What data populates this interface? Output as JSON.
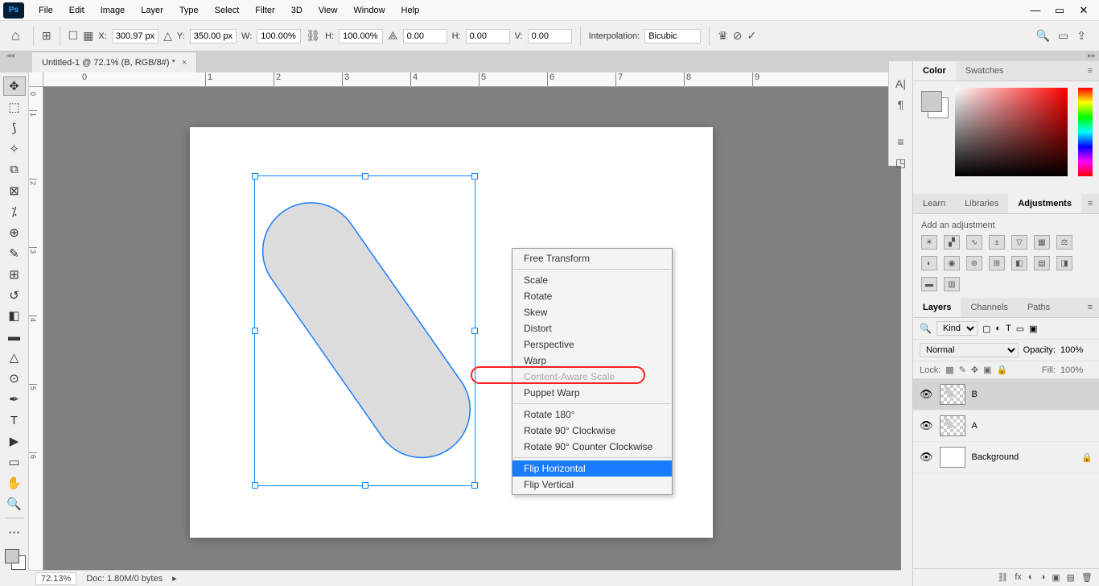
{
  "menu": {
    "items": [
      "File",
      "Edit",
      "Image",
      "Layer",
      "Type",
      "Select",
      "Filter",
      "3D",
      "View",
      "Window",
      "Help"
    ]
  },
  "options": {
    "x_label": "X:",
    "x_val": "300.97 px",
    "y_label": "Y:",
    "y_val": "350.00 px",
    "w_label": "W:",
    "w_val": "100.00%",
    "h_label": "H:",
    "h_val": "100.00%",
    "rot_val": "0.00",
    "hskew_label": "H:",
    "hskew_val": "0.00",
    "vskew_label": "V:",
    "vskew_val": "0.00",
    "interp_label": "Interpolation:",
    "interp_val": "Bicubic"
  },
  "tab": {
    "title": "Untitled-1 @ 72.1% (B, RGB/8#) *"
  },
  "ruler_h": [
    "0",
    "1",
    "2",
    "3",
    "4",
    "5",
    "6",
    "7",
    "8",
    "9"
  ],
  "ruler_v": [
    "0",
    "1",
    "2",
    "3",
    "4",
    "5",
    "6"
  ],
  "context_menu": {
    "items": [
      {
        "label": "Free Transform",
        "disabled": false,
        "sep_after": true,
        "highlighted": false
      },
      {
        "label": "Scale",
        "disabled": false,
        "highlighted": false
      },
      {
        "label": "Rotate",
        "disabled": false,
        "highlighted": false
      },
      {
        "label": "Skew",
        "disabled": false,
        "highlighted": false
      },
      {
        "label": "Distort",
        "disabled": false,
        "highlighted": false
      },
      {
        "label": "Perspective",
        "disabled": false,
        "highlighted": false
      },
      {
        "label": "Warp",
        "disabled": false,
        "highlighted": false
      },
      {
        "label": "Content-Aware Scale",
        "disabled": true,
        "highlighted": false
      },
      {
        "label": "Puppet Warp",
        "disabled": false,
        "sep_after": true,
        "highlighted": false
      },
      {
        "label": "Rotate 180°",
        "disabled": false,
        "highlighted": false
      },
      {
        "label": "Rotate 90° Clockwise",
        "disabled": false,
        "highlighted": false
      },
      {
        "label": "Rotate 90° Counter Clockwise",
        "disabled": false,
        "sep_after": true,
        "highlighted": false
      },
      {
        "label": "Flip Horizontal",
        "disabled": false,
        "highlighted": true
      },
      {
        "label": "Flip Vertical",
        "disabled": false,
        "highlighted": false
      }
    ]
  },
  "panels": {
    "color_tab": "Color",
    "swatches_tab": "Swatches",
    "learn_tab": "Learn",
    "libraries_tab": "Libraries",
    "adjustments_tab": "Adjustments",
    "add_adjustment": "Add an adjustment",
    "layers_tab": "Layers",
    "channels_tab": "Channels",
    "paths_tab": "Paths",
    "kind_label": "Kind",
    "blend_mode": "Normal",
    "opacity_label": "Opacity:",
    "opacity_val": "100%",
    "lock_label": "Lock:",
    "fill_label": "Fill:",
    "fill_val": "100%",
    "layers": [
      {
        "name": "B",
        "selected": true,
        "has_shape": true
      },
      {
        "name": "A",
        "selected": false,
        "has_shape": true
      },
      {
        "name": "Background",
        "selected": false,
        "locked": true,
        "has_shape": false
      }
    ]
  },
  "status": {
    "zoom": "72.13%",
    "doc_info": "Doc: 1.80M/0 bytes"
  }
}
